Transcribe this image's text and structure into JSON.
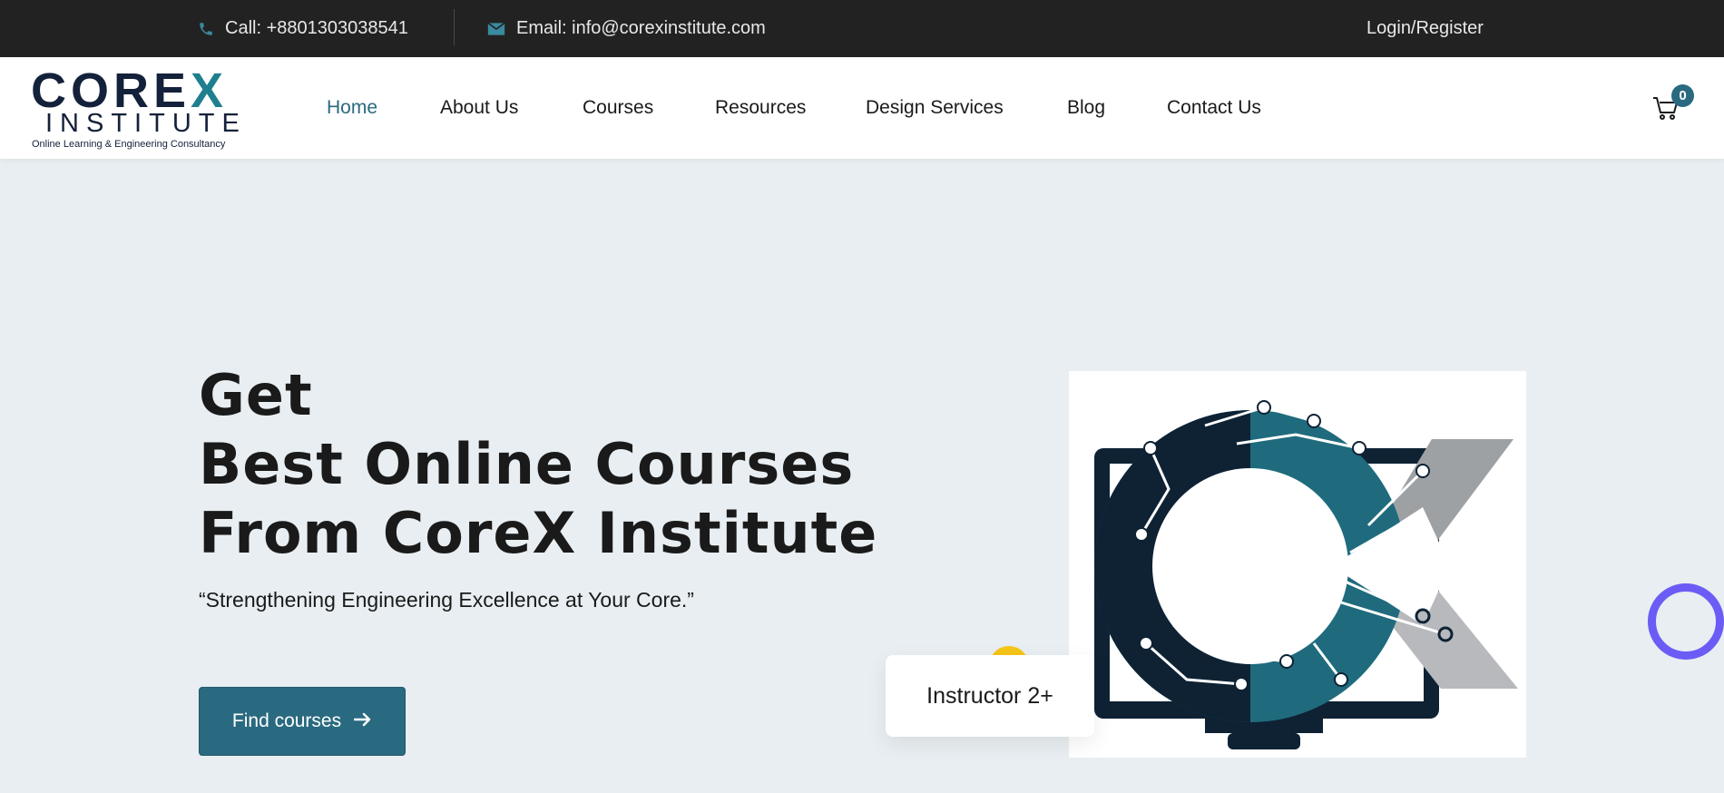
{
  "topbar": {
    "phone_text": "Call: +8801303038541",
    "email_text": "Email: info@corexinstitute.com",
    "login_label": "Login/Register",
    "phone_icon": "phone-icon",
    "email_icon": "envelope-icon"
  },
  "logo": {
    "line1_main": "CORE",
    "line1_accent": "X",
    "line2": "INSTITUTE",
    "line3": "Online Learning & Engineering Consultancy"
  },
  "nav": {
    "items": [
      {
        "label": "Home",
        "active": true
      },
      {
        "label": "About Us"
      },
      {
        "label": "Courses"
      },
      {
        "label": "Resources"
      },
      {
        "label": "Design Services"
      },
      {
        "label": "Blog"
      },
      {
        "label": "Contact Us"
      }
    ]
  },
  "cart": {
    "icon": "cart-icon",
    "count": "0"
  },
  "hero": {
    "title_line1": "Get",
    "title_line2": "Best Online Courses",
    "title_line3": "From CoreX Institute",
    "tagline": "“Strengthening Engineering Excellence at Your Core.”",
    "cta_label": "Find courses",
    "cta_icon": "arrow-right-icon",
    "badge_text": "Instructor 2+"
  },
  "colors": {
    "topbar_bg": "#222222",
    "accent": "#2a6a80",
    "hero_bg": "#e8eef1",
    "ring": "#6b5cf6",
    "dot": "#f5c518"
  }
}
